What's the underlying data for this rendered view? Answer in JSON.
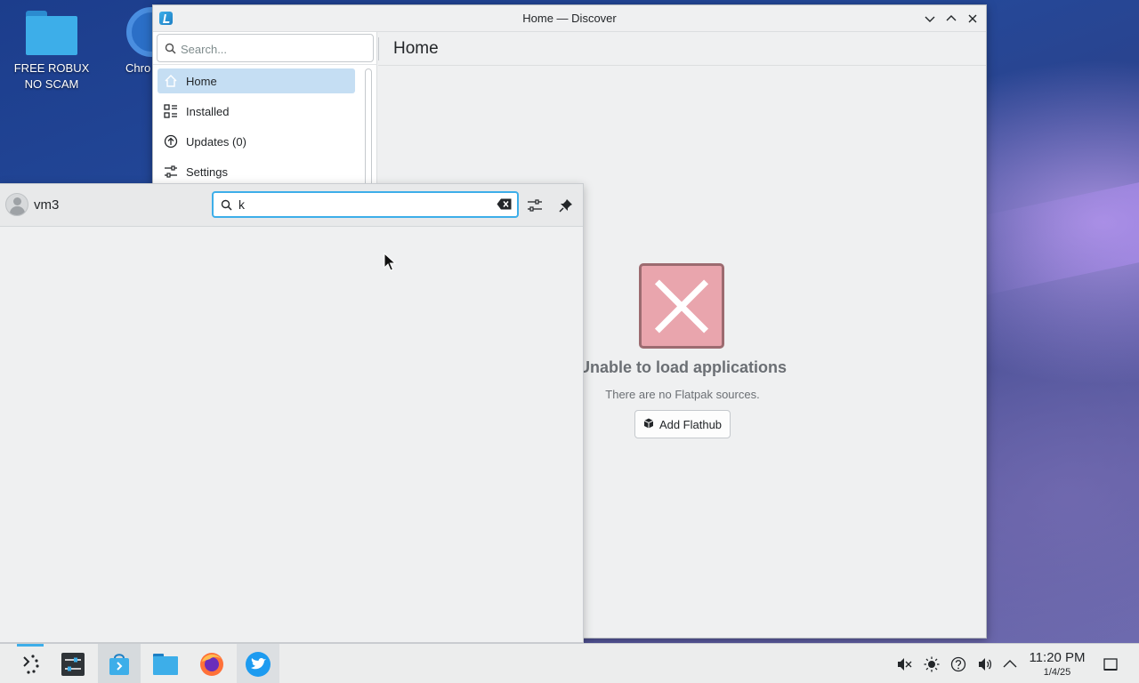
{
  "desktop": {
    "icons": [
      {
        "label": "FREE ROBUX NO SCAM"
      },
      {
        "label": "Chro"
      }
    ]
  },
  "discover": {
    "window_title": "Home — Discover",
    "search_placeholder": "Search...",
    "nav": [
      {
        "label": "Home",
        "icon": "home-icon",
        "active": true
      },
      {
        "label": "Installed",
        "icon": "installed-icon"
      },
      {
        "label": "Updates (0)",
        "icon": "updates-icon"
      },
      {
        "label": "Settings",
        "icon": "settings-icon"
      }
    ],
    "page_title": "Home",
    "error": {
      "title": "Unable to load applications",
      "subtitle": "There are no Flatpak sources.",
      "button_label": "Add Flathub"
    }
  },
  "krunner": {
    "user": "vm3",
    "query": "k"
  },
  "taskbar": {
    "apps": [
      "application-launcher-icon",
      "system-settings-icon",
      "discover-icon",
      "file-manager-icon",
      "firefox-icon",
      "twitter-icon"
    ],
    "tray": [
      "muted-volume-icon",
      "brightness-icon",
      "help-icon",
      "volume-icon",
      "expand-tray-icon"
    ],
    "clock_time": "11:20 PM",
    "clock_date": "1/4/25"
  },
  "colors": {
    "accent": "#3daee9",
    "selection": "#c5def3",
    "error_fill": "#e9a5ad"
  }
}
